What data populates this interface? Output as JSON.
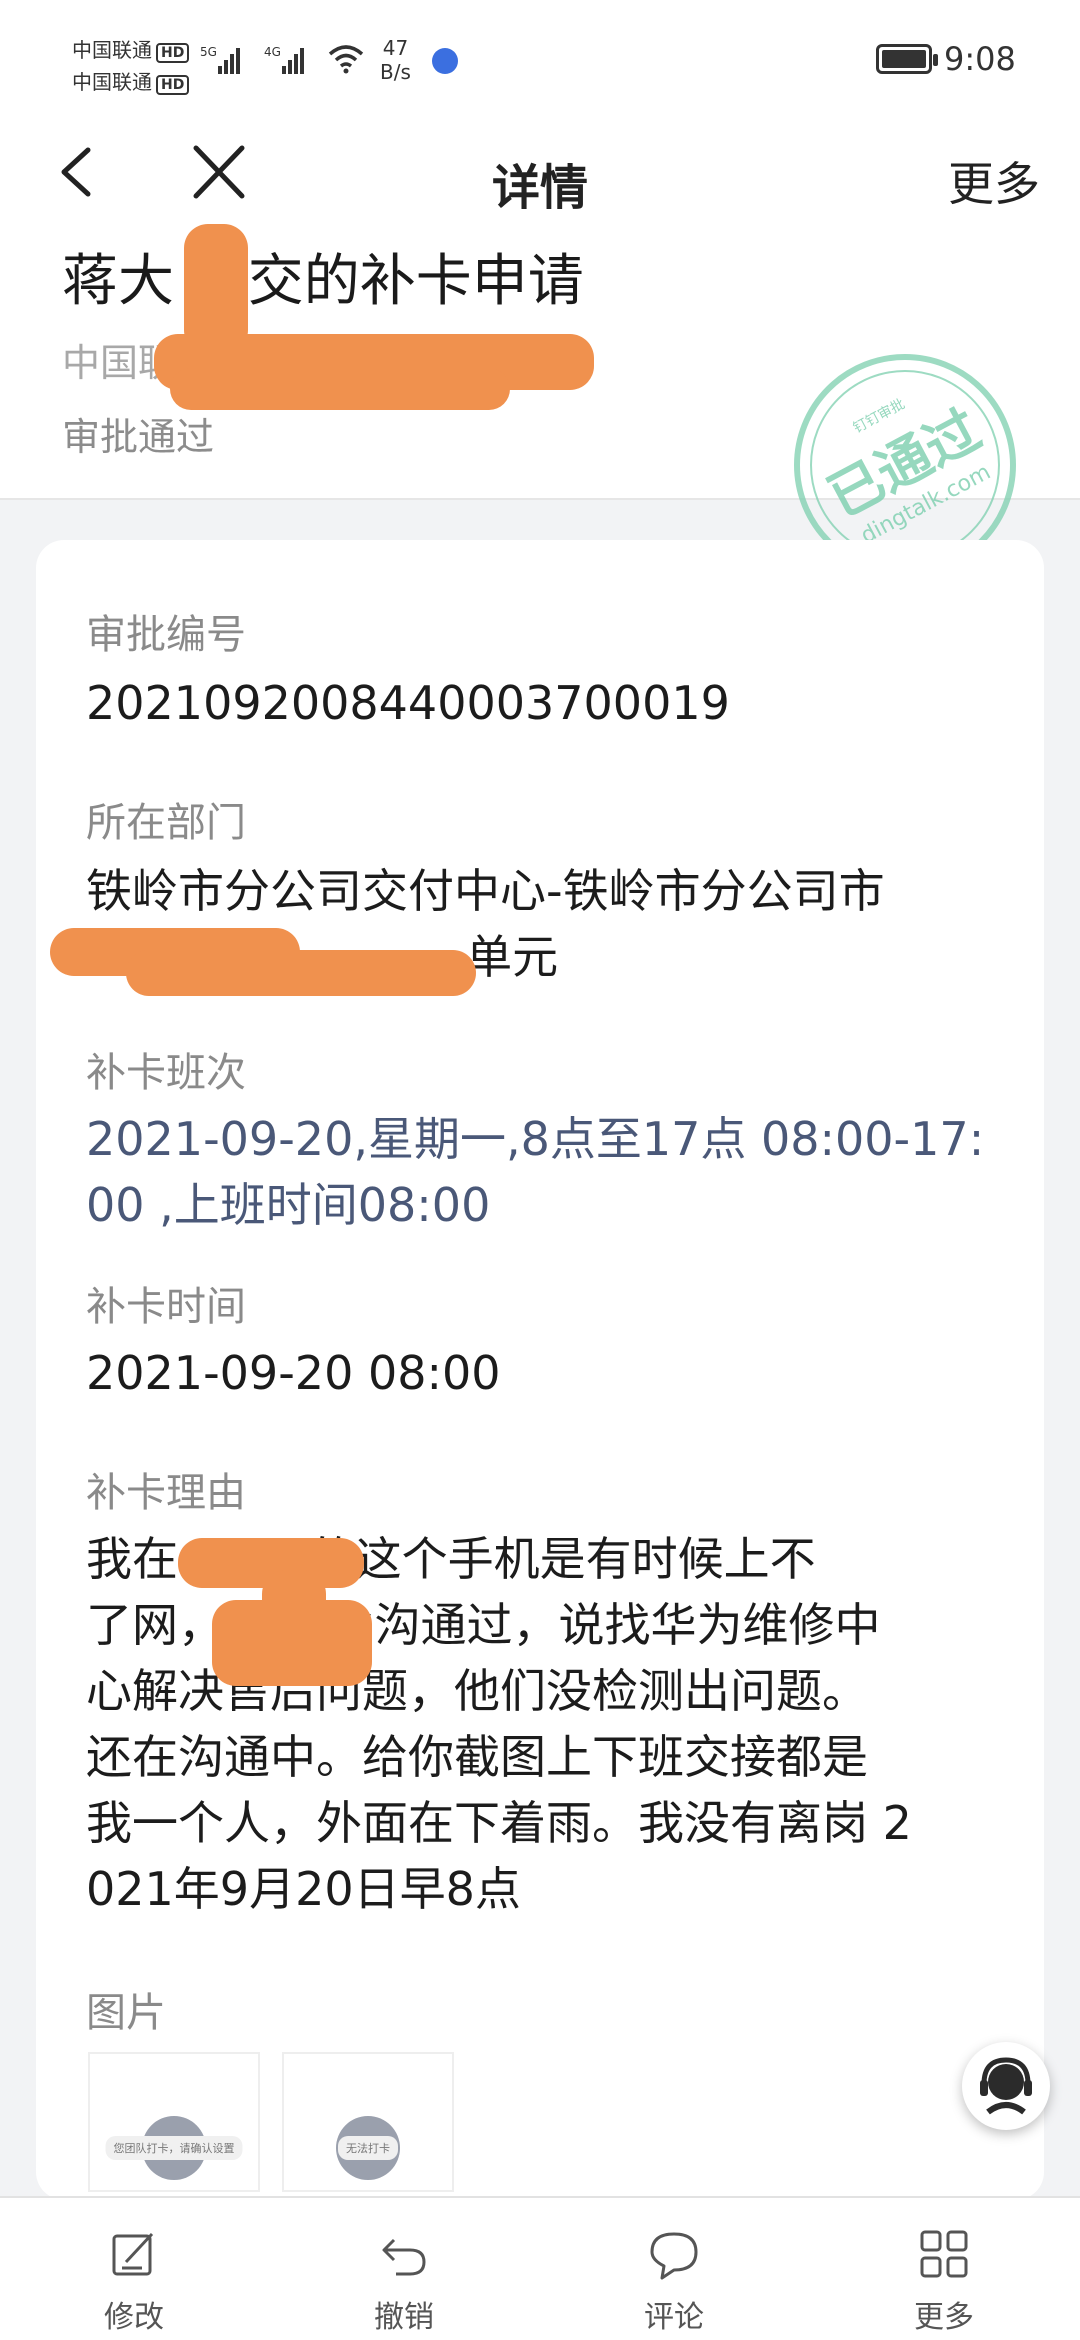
{
  "status_bar": {
    "carrier1": "中国联通",
    "carrier2": "中国联通",
    "hd_badge": "HD",
    "signal1_label": "5G",
    "signal2_label": "4G",
    "net_speed_value": "47",
    "net_speed_unit": "B/s",
    "time": "9:08",
    "icons": [
      "signal-icon",
      "wifi-icon",
      "globe-icon",
      "battery-icon"
    ]
  },
  "nav": {
    "title": "详情",
    "more_label": "更多",
    "back_icon": "chevron-left-icon",
    "close_icon": "close-icon"
  },
  "header": {
    "title": "蒋大  提交的补卡申请",
    "org": "中国联通                       岭市分公司",
    "status": "审批通过"
  },
  "stamp": {
    "main_text": "已通过",
    "top_text": "钉钉审批",
    "domain_text": "dingtalk.com",
    "color": "#7ccfae"
  },
  "fields": [
    {
      "label": "审批编号",
      "value": "2021092008440003700019"
    },
    {
      "label": "所在部门",
      "value": "铁岭市分公司交付中心-铁岭市分公司市\n                          单元"
    },
    {
      "label": "补卡班次",
      "value": "2021-09-20,星期一,8点至17点 08:00-17:\n00 ,上班时间08:00"
    },
    {
      "label": "补卡时间",
      "value": "2021-09-20 08:00"
    },
    {
      "label": "补卡理由",
      "value": "我在         的这个手机是有时候上不\n了网，跟    业沟通过，说找华为维修中\n心解决售后问题，他们没检测出问题。\n还在沟通中。给你截图上下班交接都是\n我一个人，外面在下着雨。我没有离岗 2\n021年9月20日早8点"
    },
    {
      "label": "图片",
      "value": ""
    }
  ],
  "images": [
    {
      "caption": "您团队打卡，请确认设置"
    },
    {
      "caption": "无法打卡"
    }
  ],
  "toolbar": [
    {
      "label": "修改",
      "icon": "edit-icon"
    },
    {
      "label": "撤销",
      "icon": "undo-icon"
    },
    {
      "label": "评论",
      "icon": "comment-icon"
    },
    {
      "label": "更多",
      "icon": "grid-icon"
    }
  ],
  "colors": {
    "accent_blue_text": "#4a5878",
    "redaction": "#f0914e",
    "label_gray": "#8a8a8a"
  }
}
